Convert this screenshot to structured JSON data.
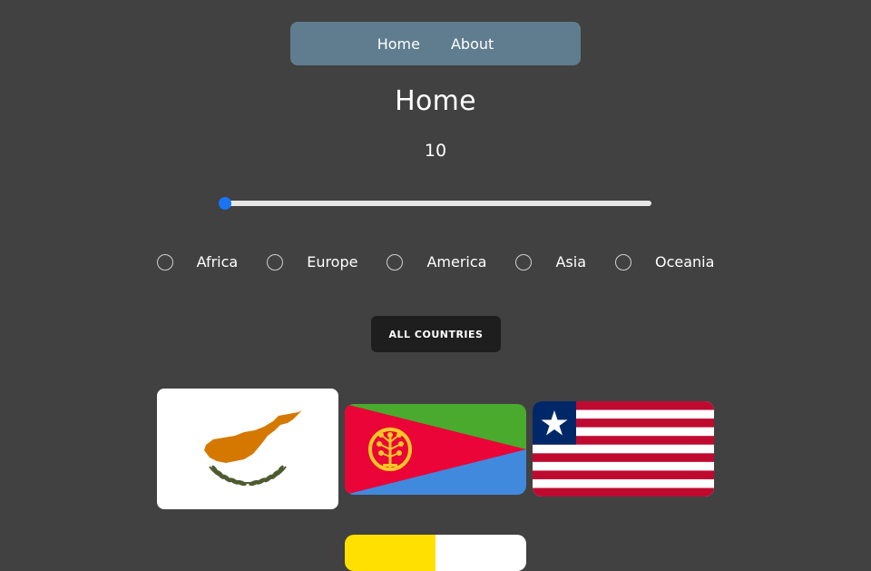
{
  "nav": {
    "items": [
      {
        "label": "Home"
      },
      {
        "label": "About"
      }
    ]
  },
  "page": {
    "title": "Home"
  },
  "slider": {
    "value": "10",
    "fraction": 0.0
  },
  "regions": [
    {
      "label": "Africa",
      "checked": false
    },
    {
      "label": "Europe",
      "checked": false
    },
    {
      "label": "America",
      "checked": false
    },
    {
      "label": "Asia",
      "checked": false
    },
    {
      "label": "Oceania",
      "checked": false
    }
  ],
  "all_countries_button": {
    "label": "ALL COUNTRIES"
  },
  "flags": [
    {
      "country": "cyprus-flag-icon"
    },
    {
      "country": "eritrea-flag-icon"
    },
    {
      "country": "liberia-flag-icon"
    },
    {
      "country": "vatican-flag-icon"
    }
  ],
  "colors": {
    "background": "#414141",
    "nav": "#5f7d8e",
    "accent": "#1a73f0",
    "button": "#1e1e1e"
  }
}
